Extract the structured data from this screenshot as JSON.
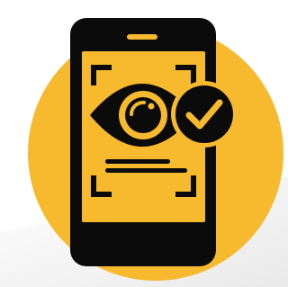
{
  "icon": {
    "name": "eye-scan-verification-icon",
    "parts": [
      "smartphone-icon",
      "scan-frame-icon",
      "eye-icon",
      "checkmark-badge-icon",
      "text-lines-icon"
    ]
  },
  "colors": {
    "background": "#ffffff",
    "circle": "#F7BA2E",
    "screen": "#F7BA2E",
    "ink": "#0b0b0b",
    "shadow": "#ececec"
  }
}
